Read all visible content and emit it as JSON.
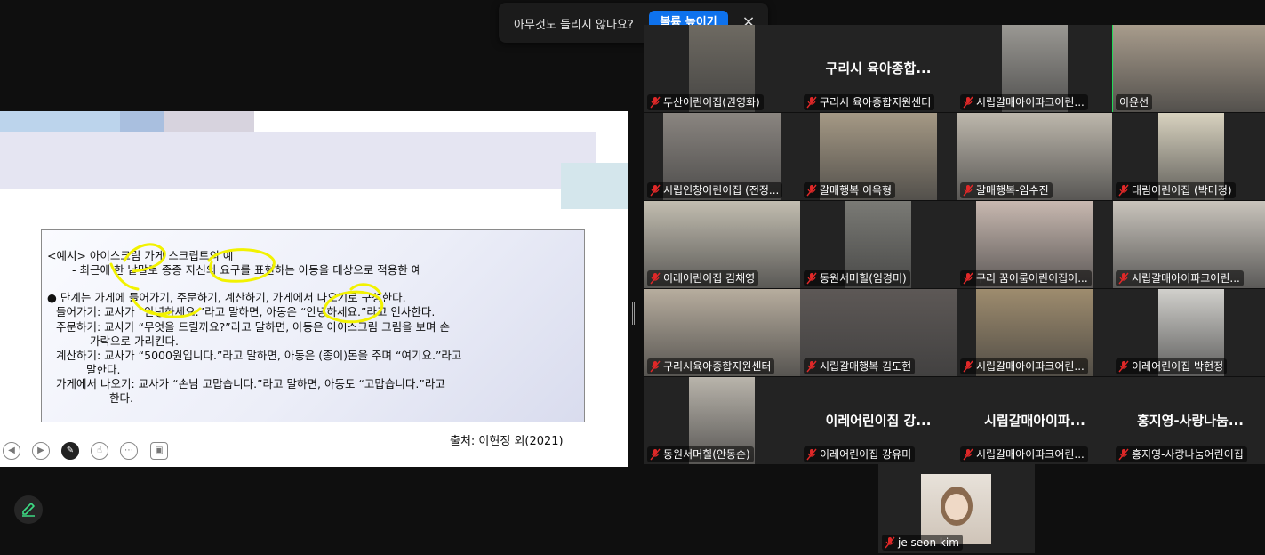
{
  "notice": {
    "message": "아무것도 들리지 않나요?",
    "button": "볼륨 높이기",
    "close": "×"
  },
  "slide": {
    "lines": [
      "<예시> 아이스크림 가게 스크립트의 예",
      "- 최근에 한 낱말로 종종 자신의 요구를 표현하는 아동을 대상으로 적용한 예",
      "● 단계는 가게에 들어가기, 주문하기, 계산하기, 가게에서 나오기로 구성한다.",
      "들어가기: 교사가 “안녕하세요.”라고 말하면, 아동은 “안녕하세요.”라고 인사한다.",
      "주문하기: 교사가 “무엇을 드릴까요?”라고 말하면, 아동은 아이스크림 그림을 보며 손",
      "가락으로 가리킨다.",
      "계산하기: 교사가 “5000원입니다.”라고 말하면, 아동은 (종이)돈을 주며 “여기요.”라고",
      "말한다.",
      "가게에서 나오기: 교사가 “손님 고맙습니다.”라고 말하면, 아동도 “고맙습니다.”라고",
      "한다."
    ],
    "source": "출처: 이현정 외(2021)"
  },
  "participants": [
    {
      "name": "두산어린이집(권영화)",
      "big_name": "",
      "video": "#6e6a62",
      "muted": true
    },
    {
      "name": "구리시 육아종합지원센터",
      "big_name": "구리시 육아종합...",
      "video": "",
      "muted": true
    },
    {
      "name": "시립갈매아이파크어린...",
      "big_name": "",
      "video": "#9a9893",
      "muted": true
    },
    {
      "name": "이윤선",
      "big_name": "",
      "video": "#a89c8c",
      "muted": false,
      "active": true
    },
    {
      "name": "시립인창어린이집 (전정...",
      "big_name": "",
      "video": "#8a8580",
      "muted": true
    },
    {
      "name": "갈매행복 이옥형",
      "big_name": "",
      "video": "#a59985",
      "muted": true
    },
    {
      "name": "갈매행복-임수진",
      "big_name": "",
      "video": "#bdb7ac",
      "muted": true
    },
    {
      "name": "대림어린이집 (박미정)",
      "big_name": "",
      "video": "#d8d2bf",
      "muted": true
    },
    {
      "name": "이레어린이집 김채영",
      "big_name": "",
      "video": "#c2bdb0",
      "muted": true
    },
    {
      "name": "동원서머힐(임경미)",
      "big_name": "",
      "video": "#7a7a75",
      "muted": true
    },
    {
      "name": "구리 꿈이룸어린이집이...",
      "big_name": "",
      "video": "#c8b8b0",
      "muted": true
    },
    {
      "name": "시립갈매아이파크어린...",
      "big_name": "",
      "video": "#c9c4bc",
      "muted": true
    },
    {
      "name": "구리시육아종합지원센터",
      "big_name": "",
      "video": "#b7ad9e",
      "muted": true
    },
    {
      "name": "시립갈매행복 김도현",
      "big_name": "",
      "video": "#5d5856",
      "muted": true
    },
    {
      "name": "시립갈매아이파크어린...",
      "big_name": "",
      "video": "#9e8c6e",
      "muted": true
    },
    {
      "name": "이레어린이집 박현정",
      "big_name": "",
      "video": "#d1d0cc",
      "muted": true
    },
    {
      "name": "동원서머힐(안동순)",
      "big_name": "",
      "video": "#b9b4ab",
      "muted": true
    },
    {
      "name": "이레어린이집 강유미",
      "big_name": "이레어린이집 강...",
      "video": "",
      "muted": true
    },
    {
      "name": "시립갈매아이파크어린...",
      "big_name": "시립갈매아이파...",
      "video": "",
      "muted": true
    },
    {
      "name": "홍지영-사랑나눔어린이집",
      "big_name": "홍지영-사랑나눔...",
      "video": "",
      "muted": true
    }
  ],
  "self_view": {
    "name": "je seon kim",
    "muted": true
  },
  "colors": {
    "accent": "#0e72ed",
    "active_speaker": "#23d959",
    "muted_icon": "#e02828"
  }
}
